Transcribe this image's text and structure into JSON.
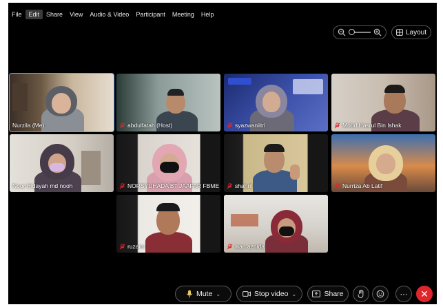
{
  "menubar": {
    "items": [
      {
        "label": "File",
        "active": false
      },
      {
        "label": "Edit",
        "active": true
      },
      {
        "label": "Share",
        "active": false
      },
      {
        "label": "View",
        "active": false
      },
      {
        "label": "Audio & Video",
        "active": false
      },
      {
        "label": "Participant",
        "active": false
      },
      {
        "label": "Meeting",
        "active": false
      },
      {
        "label": "Help",
        "active": false
      }
    ]
  },
  "view_controls": {
    "zoom_out_icon": "zoom-out-icon",
    "zoom_in_icon": "zoom-in-icon",
    "zoom_level": 0,
    "layout_label": "Layout"
  },
  "participants": [
    {
      "name": "Nurzila (Me)",
      "muted": false
    },
    {
      "name": "abdulfatah (Host)",
      "muted": true
    },
    {
      "name": "syazwaniitri",
      "muted": true
    },
    {
      "name": "Mohd Hasrul Bin Ishak",
      "muted": true
    },
    {
      "name": "Noor Hidayah md nooh",
      "muted": false
    },
    {
      "name": "NORSYUHADA BT JAAFAR FBME",
      "muted": true
    },
    {
      "name": "shahril",
      "muted": true
    },
    {
      "name": "Nurriza Ab Latif",
      "muted": true
    },
    {
      "name": "ruzaini",
      "muted": true
    },
    {
      "name": "wan aznida",
      "muted": true
    }
  ],
  "toolbar": {
    "mute_label": "Mute",
    "stop_video_label": "Stop video",
    "share_label": "Share"
  },
  "colors": {
    "selected_outline": "#57a3ff",
    "leave": "#e0262d",
    "muted_icon": "#e0262d"
  }
}
